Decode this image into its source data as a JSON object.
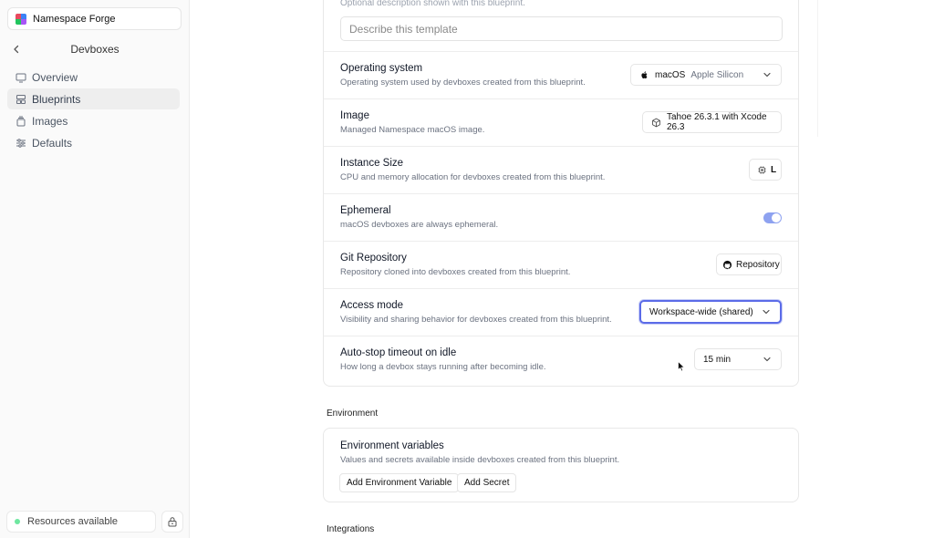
{
  "sidebar": {
    "org_name": "Namespace Forge",
    "title": "Devboxes",
    "items": [
      {
        "label": "Overview",
        "icon": "monitor-icon",
        "active": false
      },
      {
        "label": "Blueprints",
        "icon": "blueprint-icon",
        "active": true
      },
      {
        "label": "Images",
        "icon": "layers-icon",
        "active": false
      },
      {
        "label": "Defaults",
        "icon": "sliders-icon",
        "active": false
      }
    ],
    "resources_label": "Resources available",
    "status_color": "#6ee7a0"
  },
  "form": {
    "description_hint": "Optional description shown with this blueprint.",
    "description_placeholder": "Describe this template",
    "rows": {
      "os": {
        "title": "Operating system",
        "subtitle": "Operating system used by devboxes created from this blueprint.",
        "value": "macOS",
        "detail": "Apple Silicon"
      },
      "image": {
        "title": "Image",
        "subtitle": "Managed Namespace macOS image.",
        "value": "Tahoe 26.3.1 with Xcode 26.3"
      },
      "instance": {
        "title": "Instance Size",
        "subtitle": "CPU and memory allocation for devboxes created from this blueprint.",
        "value": "L"
      },
      "ephemeral": {
        "title": "Ephemeral",
        "subtitle": "macOS devboxes are always ephemeral.",
        "enabled": true
      },
      "git": {
        "title": "Git Repository",
        "subtitle": "Repository cloned into devboxes created from this blueprint.",
        "value": "Repository"
      },
      "access": {
        "title": "Access mode",
        "subtitle": "Visibility and sharing behavior for devboxes created from this blueprint.",
        "value": "Workspace-wide (shared)"
      },
      "autostop": {
        "title": "Auto-stop timeout on idle",
        "subtitle": "How long a devbox stays running after becoming idle.",
        "value": "15 min"
      }
    }
  },
  "environment": {
    "section_label": "Environment",
    "title": "Environment variables",
    "subtitle": "Values and secrets available inside devboxes created from this blueprint.",
    "add_variable_label": "Add Environment Variable",
    "add_secret_label": "Add Secret"
  },
  "integrations": {
    "section_label": "Integrations"
  },
  "colors": {
    "accent": "#5b6be8",
    "toggle_on": "#8ea2f0"
  }
}
